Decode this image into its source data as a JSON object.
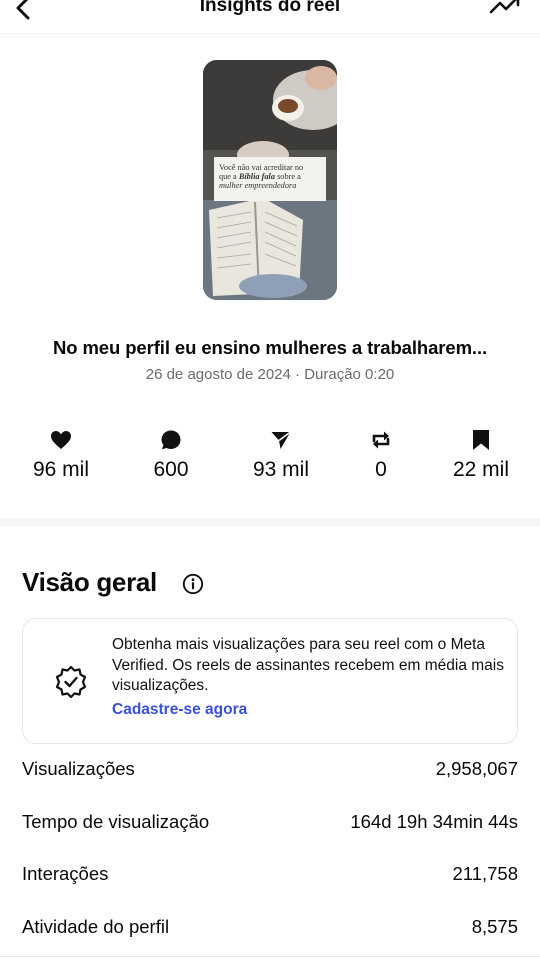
{
  "header": {
    "title": "Insights do reel",
    "back_icon": "chevron-left-icon",
    "trend_icon": "trending-up-icon"
  },
  "thumbnail": {
    "caption_line1": "Você não vai acreditar no",
    "caption_line2_pre": "que a ",
    "caption_line2_em": "Bíblia fala",
    "caption_line2_post": " sobre a",
    "caption_line3": "mulher empreendedora"
  },
  "reel": {
    "title": "No meu perfil eu ensino mulheres a trabalharem...",
    "meta": "26 de agosto de 2024 · Duração 0:20"
  },
  "stats": [
    {
      "icon": "heart-icon",
      "value": "96 mil"
    },
    {
      "icon": "comment-icon",
      "value": "600"
    },
    {
      "icon": "share-icon",
      "value": "93 mil"
    },
    {
      "icon": "repost-icon",
      "value": "0"
    },
    {
      "icon": "bookmark-icon",
      "value": "22 mil"
    }
  ],
  "overview": {
    "title": "Visão geral",
    "info_icon": "info-icon"
  },
  "promo": {
    "icon": "verified-badge-icon",
    "text": "Obtenha mais visualizações para seu reel com o Meta Verified. Os reels de assinantes recebem em média mais visualizações.",
    "link": "Cadastre-se agora",
    "link_color": "#3a4fd8"
  },
  "metrics": [
    {
      "label": "Visualizações",
      "value": "2,958,067"
    },
    {
      "label": "Tempo de visualização",
      "value": "164d 19h 34min 44s"
    },
    {
      "label": "Interações",
      "value": "211,758"
    },
    {
      "label": "Atividade do perfil",
      "value": "8,575"
    }
  ]
}
